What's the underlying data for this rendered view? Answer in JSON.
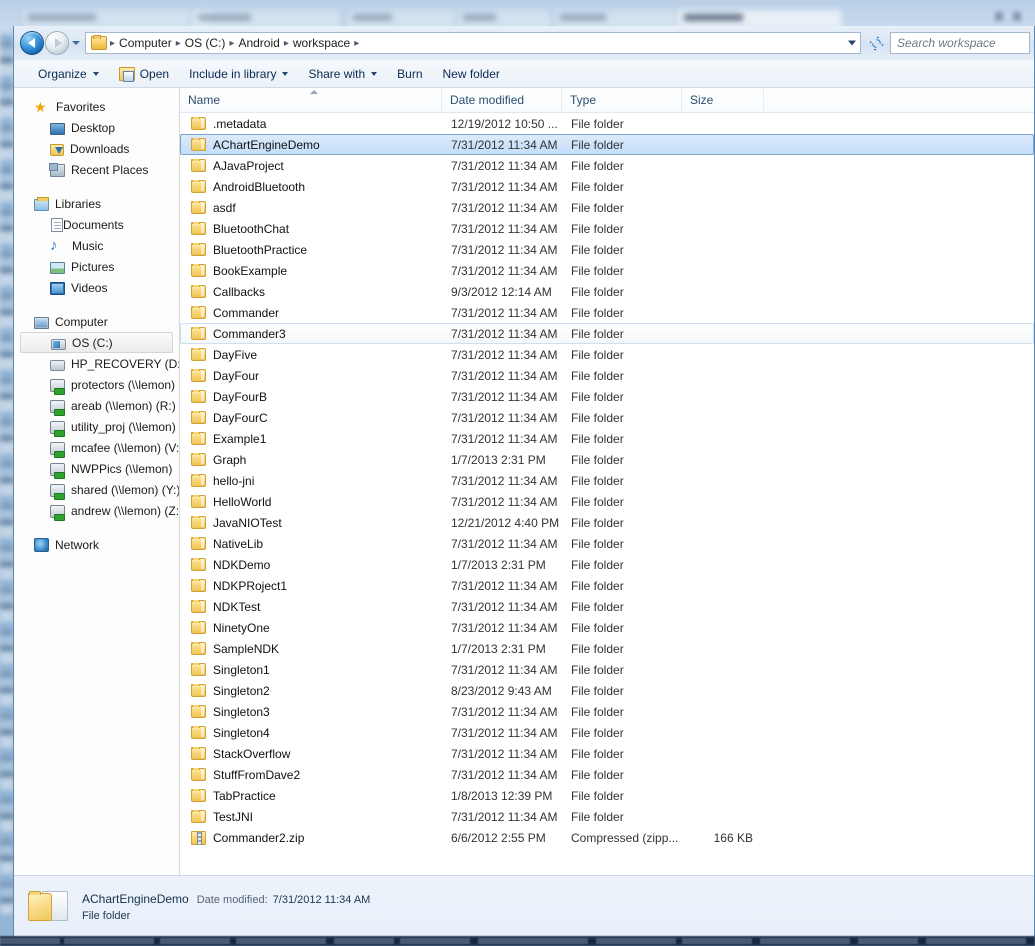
{
  "window": {
    "title": "workspace"
  },
  "addressbar": {
    "back_icon": "back-arrow-icon",
    "forward_icon": "forward-arrow-icon",
    "history_icon": "history-dropdown-icon",
    "folder_icon": "folder-icon",
    "separator": "▸",
    "crumbs": [
      "Computer",
      "OS (C:)",
      "Android",
      "workspace"
    ],
    "dropdown_icon": "chevron-down-icon",
    "refresh_icon": "refresh-icon",
    "search_placeholder": "Search workspace"
  },
  "toolbar": {
    "items": [
      {
        "label": "Organize",
        "caret": true,
        "icon": null
      },
      {
        "label": "Open",
        "caret": false,
        "icon": "open-folder-icon"
      },
      {
        "label": "Include in library",
        "caret": true,
        "icon": null
      },
      {
        "label": "Share with",
        "caret": true,
        "icon": null
      },
      {
        "label": "Burn",
        "caret": false,
        "icon": null
      },
      {
        "label": "New folder",
        "caret": false,
        "icon": null
      }
    ]
  },
  "navpane": {
    "groups": [
      {
        "header": {
          "label": "Favorites",
          "icon": "star-icon"
        },
        "items": [
          {
            "label": "Desktop",
            "icon": "desktop-icon"
          },
          {
            "label": "Downloads",
            "icon": "downloads-icon"
          },
          {
            "label": "Recent Places",
            "icon": "recent-places-icon"
          }
        ]
      },
      {
        "header": {
          "label": "Libraries",
          "icon": "libraries-icon"
        },
        "items": [
          {
            "label": "Documents",
            "icon": "documents-icon"
          },
          {
            "label": "Music",
            "icon": "music-icon"
          },
          {
            "label": "Pictures",
            "icon": "pictures-icon"
          },
          {
            "label": "Videos",
            "icon": "videos-icon"
          }
        ]
      },
      {
        "header": {
          "label": "Computer",
          "icon": "computer-icon"
        },
        "items": [
          {
            "label": "OS (C:)",
            "icon": "hdd-os-icon",
            "selected": true
          },
          {
            "label": "HP_RECOVERY (D:)",
            "icon": "hdd-icon"
          },
          {
            "label": "protectors (\\\\lemon)",
            "icon": "network-drive-icon"
          },
          {
            "label": "areab (\\\\lemon) (R:)",
            "icon": "network-drive-icon"
          },
          {
            "label": "utility_proj (\\\\lemon)",
            "icon": "network-drive-icon"
          },
          {
            "label": "mcafee (\\\\lemon) (V:)",
            "icon": "network-drive-icon"
          },
          {
            "label": "NWPPics (\\\\lemon)",
            "icon": "network-drive-icon"
          },
          {
            "label": "shared (\\\\lemon) (Y:)",
            "icon": "network-drive-icon"
          },
          {
            "label": "andrew (\\\\lemon) (Z:)",
            "icon": "network-drive-icon"
          }
        ]
      },
      {
        "header": {
          "label": "Network",
          "icon": "network-icon"
        },
        "items": []
      }
    ]
  },
  "list": {
    "columns": [
      {
        "key": "name",
        "label": "Name",
        "sorted": "asc"
      },
      {
        "key": "date",
        "label": "Date modified"
      },
      {
        "key": "type",
        "label": "Type"
      },
      {
        "key": "size",
        "label": "Size"
      }
    ],
    "rows": [
      {
        "name": ".metadata",
        "date": "12/19/2012 10:50 ...",
        "type": "File folder",
        "size": "",
        "icon": "folder-icon",
        "state": ""
      },
      {
        "name": "AChartEngineDemo",
        "date": "7/31/2012 11:34 AM",
        "type": "File folder",
        "size": "",
        "icon": "folder-icon",
        "state": "selected"
      },
      {
        "name": "AJavaProject",
        "date": "7/31/2012 11:34 AM",
        "type": "File folder",
        "size": "",
        "icon": "folder-icon",
        "state": ""
      },
      {
        "name": "AndroidBluetooth",
        "date": "7/31/2012 11:34 AM",
        "type": "File folder",
        "size": "",
        "icon": "folder-icon",
        "state": ""
      },
      {
        "name": "asdf",
        "date": "7/31/2012 11:34 AM",
        "type": "File folder",
        "size": "",
        "icon": "folder-icon",
        "state": ""
      },
      {
        "name": "BluetoothChat",
        "date": "7/31/2012 11:34 AM",
        "type": "File folder",
        "size": "",
        "icon": "folder-icon",
        "state": ""
      },
      {
        "name": "BluetoothPractice",
        "date": "7/31/2012 11:34 AM",
        "type": "File folder",
        "size": "",
        "icon": "folder-icon",
        "state": ""
      },
      {
        "name": "BookExample",
        "date": "7/31/2012 11:34 AM",
        "type": "File folder",
        "size": "",
        "icon": "folder-icon",
        "state": ""
      },
      {
        "name": "Callbacks",
        "date": "9/3/2012 12:14 AM",
        "type": "File folder",
        "size": "",
        "icon": "folder-icon",
        "state": ""
      },
      {
        "name": "Commander",
        "date": "7/31/2012 11:34 AM",
        "type": "File folder",
        "size": "",
        "icon": "folder-icon",
        "state": ""
      },
      {
        "name": "Commander3",
        "date": "7/31/2012 11:34 AM",
        "type": "File folder",
        "size": "",
        "icon": "folder-icon",
        "state": "focused"
      },
      {
        "name": "DayFive",
        "date": "7/31/2012 11:34 AM",
        "type": "File folder",
        "size": "",
        "icon": "folder-icon",
        "state": ""
      },
      {
        "name": "DayFour",
        "date": "7/31/2012 11:34 AM",
        "type": "File folder",
        "size": "",
        "icon": "folder-icon",
        "state": ""
      },
      {
        "name": "DayFourB",
        "date": "7/31/2012 11:34 AM",
        "type": "File folder",
        "size": "",
        "icon": "folder-icon",
        "state": ""
      },
      {
        "name": "DayFourC",
        "date": "7/31/2012 11:34 AM",
        "type": "File folder",
        "size": "",
        "icon": "folder-icon",
        "state": ""
      },
      {
        "name": "Example1",
        "date": "7/31/2012 11:34 AM",
        "type": "File folder",
        "size": "",
        "icon": "folder-icon",
        "state": ""
      },
      {
        "name": "Graph",
        "date": "1/7/2013 2:31 PM",
        "type": "File folder",
        "size": "",
        "icon": "folder-icon",
        "state": ""
      },
      {
        "name": "hello-jni",
        "date": "7/31/2012 11:34 AM",
        "type": "File folder",
        "size": "",
        "icon": "folder-icon",
        "state": ""
      },
      {
        "name": "HelloWorld",
        "date": "7/31/2012 11:34 AM",
        "type": "File folder",
        "size": "",
        "icon": "folder-icon",
        "state": ""
      },
      {
        "name": "JavaNIOTest",
        "date": "12/21/2012 4:40 PM",
        "type": "File folder",
        "size": "",
        "icon": "folder-icon",
        "state": ""
      },
      {
        "name": "NativeLib",
        "date": "7/31/2012 11:34 AM",
        "type": "File folder",
        "size": "",
        "icon": "folder-icon",
        "state": ""
      },
      {
        "name": "NDKDemo",
        "date": "1/7/2013 2:31 PM",
        "type": "File folder",
        "size": "",
        "icon": "folder-icon",
        "state": ""
      },
      {
        "name": "NDKPRoject1",
        "date": "7/31/2012 11:34 AM",
        "type": "File folder",
        "size": "",
        "icon": "folder-icon",
        "state": ""
      },
      {
        "name": "NDKTest",
        "date": "7/31/2012 11:34 AM",
        "type": "File folder",
        "size": "",
        "icon": "folder-icon",
        "state": ""
      },
      {
        "name": "NinetyOne",
        "date": "7/31/2012 11:34 AM",
        "type": "File folder",
        "size": "",
        "icon": "folder-icon",
        "state": ""
      },
      {
        "name": "SampleNDK",
        "date": "1/7/2013 2:31 PM",
        "type": "File folder",
        "size": "",
        "icon": "folder-icon",
        "state": ""
      },
      {
        "name": "Singleton1",
        "date": "7/31/2012 11:34 AM",
        "type": "File folder",
        "size": "",
        "icon": "folder-icon",
        "state": ""
      },
      {
        "name": "Singleton2",
        "date": "8/23/2012 9:43 AM",
        "type": "File folder",
        "size": "",
        "icon": "folder-icon",
        "state": ""
      },
      {
        "name": "Singleton3",
        "date": "7/31/2012 11:34 AM",
        "type": "File folder",
        "size": "",
        "icon": "folder-icon",
        "state": ""
      },
      {
        "name": "Singleton4",
        "date": "7/31/2012 11:34 AM",
        "type": "File folder",
        "size": "",
        "icon": "folder-icon",
        "state": ""
      },
      {
        "name": "StackOverflow",
        "date": "7/31/2012 11:34 AM",
        "type": "File folder",
        "size": "",
        "icon": "folder-icon",
        "state": ""
      },
      {
        "name": "StuffFromDave2",
        "date": "7/31/2012 11:34 AM",
        "type": "File folder",
        "size": "",
        "icon": "folder-icon",
        "state": ""
      },
      {
        "name": "TabPractice",
        "date": "1/8/2013 12:39 PM",
        "type": "File folder",
        "size": "",
        "icon": "folder-icon",
        "state": ""
      },
      {
        "name": "TestJNI",
        "date": "7/31/2012 11:34 AM",
        "type": "File folder",
        "size": "",
        "icon": "folder-icon",
        "state": ""
      },
      {
        "name": "Commander2.zip",
        "date": "6/6/2012 2:55 PM",
        "type": "Compressed (zipp...",
        "size": "166 KB",
        "icon": "zip-icon",
        "state": ""
      }
    ]
  },
  "details": {
    "icon": "folder-icon-large",
    "name": "AChartEngineDemo",
    "date_label": "Date modified:",
    "date_value": "7/31/2012 11:34 AM",
    "type": "File folder"
  },
  "colors": {
    "selection_fill": "#cfe4fa",
    "selection_border": "#7da2ce",
    "folder_yellow": "#f0c455",
    "crumb_text": "#1e1e1e",
    "window_chrome": "#dce7f4"
  }
}
